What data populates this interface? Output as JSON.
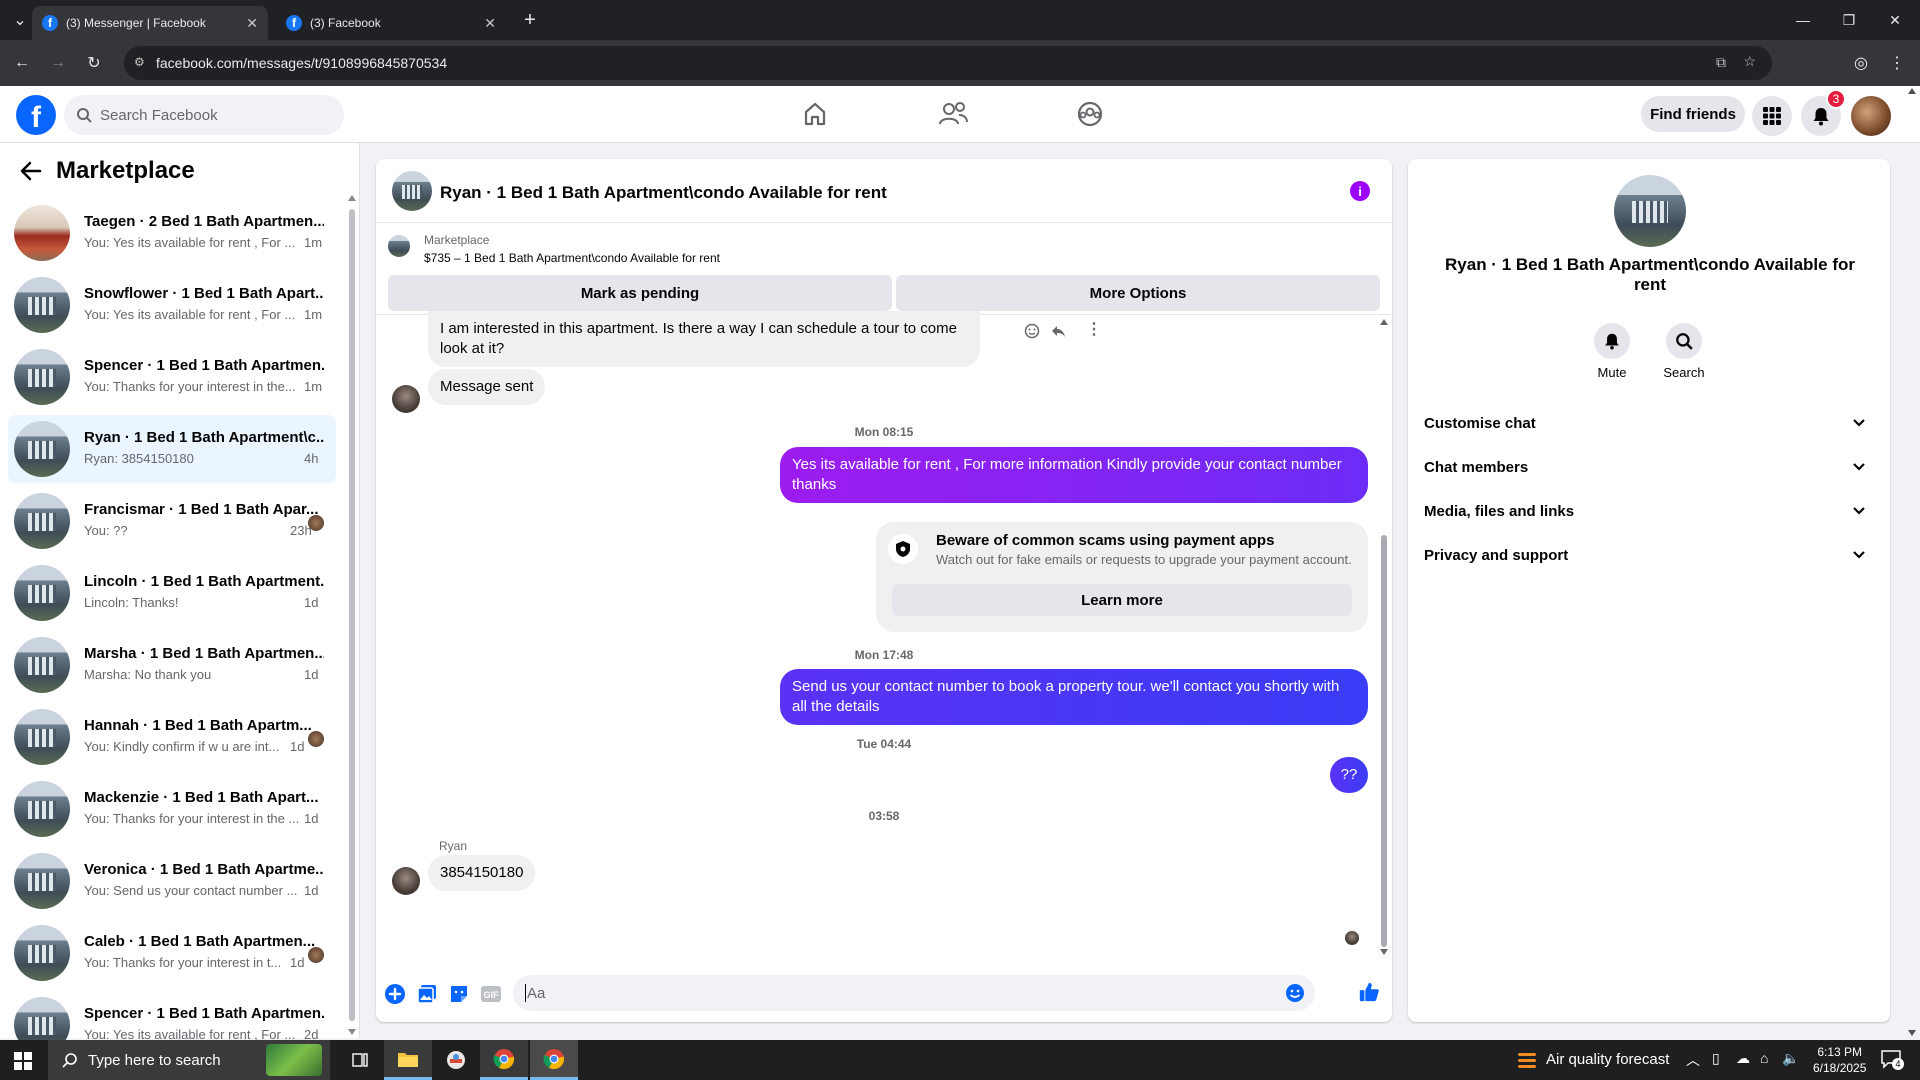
{
  "browser": {
    "tabs": [
      {
        "title": "(3) Messenger | Facebook",
        "active": true
      },
      {
        "title": "(3) Facebook",
        "active": false
      }
    ],
    "url": "facebook.com/messages/t/9108996845870534"
  },
  "header": {
    "search_placeholder": "Search Facebook",
    "find_friends": "Find friends",
    "notification_count": "3"
  },
  "sidebar": {
    "title": "Marketplace",
    "conversations": [
      {
        "name": "Taegen · 2 Bed 1 Bath Apartmen...",
        "preview": "You: Yes its available for rent , For ...",
        "time": "1m",
        "thumb": "red",
        "selected": false,
        "seen_avatar": false
      },
      {
        "name": "Snowflower · 1 Bed 1 Bath Apart...",
        "preview": "You: Yes its available for rent , For ...",
        "time": "1m",
        "thumb": "building",
        "selected": false,
        "seen_avatar": false
      },
      {
        "name": "Spencer · 1 Bed 1 Bath Apartmen...",
        "preview": "You: Thanks for your interest in the...",
        "time": "1m",
        "thumb": "building",
        "selected": false,
        "seen_avatar": false
      },
      {
        "name": "Ryan · 1 Bed 1 Bath Apartment\\c...",
        "preview": "Ryan: 3854150180",
        "time": "4h",
        "thumb": "building",
        "selected": true,
        "seen_avatar": false
      },
      {
        "name": "Francismar · 1 Bed 1 Bath Apar...",
        "preview": "You: ??",
        "time": "23h",
        "thumb": "building",
        "selected": false,
        "seen_avatar": true
      },
      {
        "name": "Lincoln · 1 Bed 1 Bath Apartment...",
        "preview": "Lincoln: Thanks!",
        "time": "1d",
        "thumb": "building",
        "selected": false,
        "seen_avatar": false
      },
      {
        "name": "Marsha · 1 Bed 1 Bath Apartmen...",
        "preview": "Marsha: No thank you",
        "time": "1d",
        "thumb": "building",
        "selected": false,
        "seen_avatar": false
      },
      {
        "name": "Hannah · 1 Bed 1 Bath Apartm...",
        "preview": "You: Kindly confirm if w u are int...",
        "time": "1d",
        "thumb": "building",
        "selected": false,
        "seen_avatar": true
      },
      {
        "name": "Mackenzie · 1 Bed 1 Bath Apart...",
        "preview": "You: Thanks for your interest in the ...",
        "time": "1d",
        "thumb": "building",
        "selected": false,
        "seen_avatar": false
      },
      {
        "name": "Veronica · 1 Bed 1 Bath Apartme...",
        "preview": "You: Send us your contact number ...",
        "time": "1d",
        "thumb": "building",
        "selected": false,
        "seen_avatar": false
      },
      {
        "name": "Caleb · 1 Bed 1 Bath Apartmen...",
        "preview": "You: Thanks for your interest in t...",
        "time": "1d",
        "thumb": "building",
        "selected": false,
        "seen_avatar": true
      },
      {
        "name": "Spencer · 1 Bed 1 Bath Apartmen...",
        "preview": "You: Yes its available for rent , For ...",
        "time": "2d",
        "thumb": "building",
        "selected": false,
        "seen_avatar": false
      }
    ]
  },
  "chat": {
    "title": "Ryan · 1 Bed 1 Bath Apartment\\condo Available for rent",
    "marketplace_label": "Marketplace",
    "listing": "$735 – 1 Bed 1 Bath Apartment\\condo Available for rent",
    "mark_pending": "Mark as pending",
    "more_options": "More Options",
    "msg_interest": "I am interested in this apartment. Is there a way I can schedule a tour to come look at it?",
    "msg_sent": "Message sent",
    "stamp1": "Mon 08:15",
    "msg_available": "Yes its  available for rent , For more information Kindly provide your contact number thanks",
    "scam_title": "Beware of common scams using payment apps",
    "scam_body": "Watch out for fake emails or requests to upgrade your payment account.",
    "learn_more": "Learn more",
    "stamp2": "Mon 17:48",
    "msg_contact": "Send us your contact number to book a property tour. we'll contact you shortly with all the details",
    "stamp3": "Tue 04:44",
    "msg_qq": "??",
    "stamp4": "03:58",
    "sender_name": "Ryan",
    "msg_phone": "3854150180",
    "composer_placeholder": "Aa"
  },
  "details": {
    "title": "Ryan · 1 Bed 1 Bath Apartment\\condo Available for rent",
    "mute": "Mute",
    "search": "Search",
    "sections": [
      "Customise chat",
      "Chat members",
      "Media, files and links",
      "Privacy and support"
    ]
  },
  "taskbar": {
    "search_placeholder": "Type here to search",
    "weather": "Air quality forecast",
    "time": "6:13 PM",
    "date": "6/18/2025",
    "notif_count": "4"
  },
  "colors": {
    "fb_blue": "#0866ff",
    "accent_purple": "#9b00ff",
    "selected_row": "#ebf5ff"
  }
}
